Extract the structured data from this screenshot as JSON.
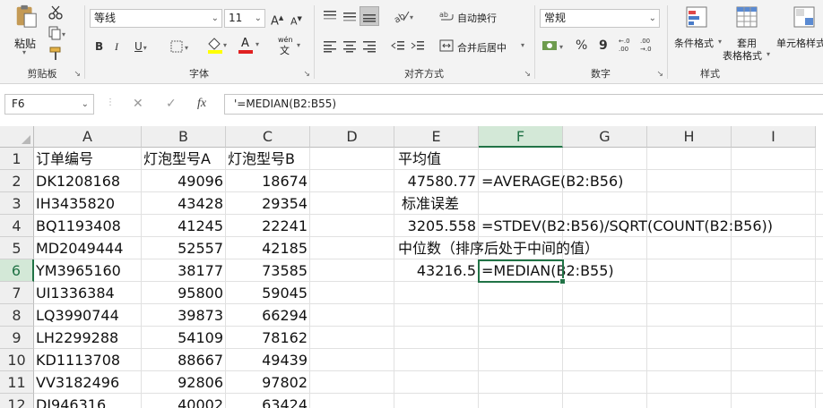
{
  "ribbon": {
    "clipboard": {
      "paste": "粘贴",
      "label": "剪贴板"
    },
    "font": {
      "name": "等线",
      "size": "11",
      "grow": "A",
      "shrink": "A",
      "bold": "B",
      "italic": "I",
      "underline": "U",
      "font_color": "A",
      "phonetic": "wén",
      "label": "字体"
    },
    "align": {
      "wrap": "自动换行",
      "merge": "合并后居中",
      "label": "对齐方式"
    },
    "number": {
      "format": "常规",
      "percent": "%",
      "comma": "9",
      "inc_dec": "←.0 .00",
      "dec_dec": ".00 →.0",
      "label": "数字"
    },
    "styles": {
      "cond": "条件格式",
      "table_line1": "套用",
      "table_line2": "表格格式",
      "cell": "单元格样式",
      "label": "样式"
    }
  },
  "formula_bar": {
    "name_box": "F6",
    "cancel": "✕",
    "enter": "✓",
    "fx": "fx",
    "content": "'=MEDIAN(B2:B55)"
  },
  "grid": {
    "columns": [
      "A",
      "B",
      "C",
      "D",
      "E",
      "F",
      "G",
      "H",
      "I"
    ],
    "rows": [
      "1",
      "2",
      "3",
      "4",
      "5",
      "6",
      "7",
      "8",
      "9",
      "10",
      "11",
      "12"
    ],
    "A": [
      "订单编号",
      "DK1208168",
      "IH3435820",
      "BQ1193408",
      "MD2049444",
      "YM3965160",
      "UI1336384",
      "LQ3990744",
      "LH2299288",
      "KD1113708",
      "VV3182496",
      "DJ946316"
    ],
    "B": [
      "灯泡型号A",
      "49096",
      "43428",
      "41245",
      "52557",
      "38177",
      "95800",
      "39873",
      "54109",
      "88667",
      "92806",
      "40002"
    ],
    "C": [
      "灯泡型号B",
      "18674",
      "29354",
      "22241",
      "42185",
      "73585",
      "59045",
      "66294",
      "78162",
      "49439",
      "97802",
      "63424"
    ],
    "E1": "平均值",
    "E2": "47580.77",
    "E3": "标准误差",
    "E4": "3205.558",
    "E5": "中位数（排序后处于中间的值）",
    "E6": "43216.5",
    "F2": "=AVERAGE(B2:B56)",
    "F4": "=STDEV(B2:B56)/SQRT(COUNT(B2:B56))",
    "F6": "=MEDIAN(B2:B55)"
  },
  "colors": {
    "accent": "#217346",
    "header_bg": "#efefef",
    "active_header_bg": "#d3e8d7",
    "ribbon_bg": "#f3f3f3"
  }
}
